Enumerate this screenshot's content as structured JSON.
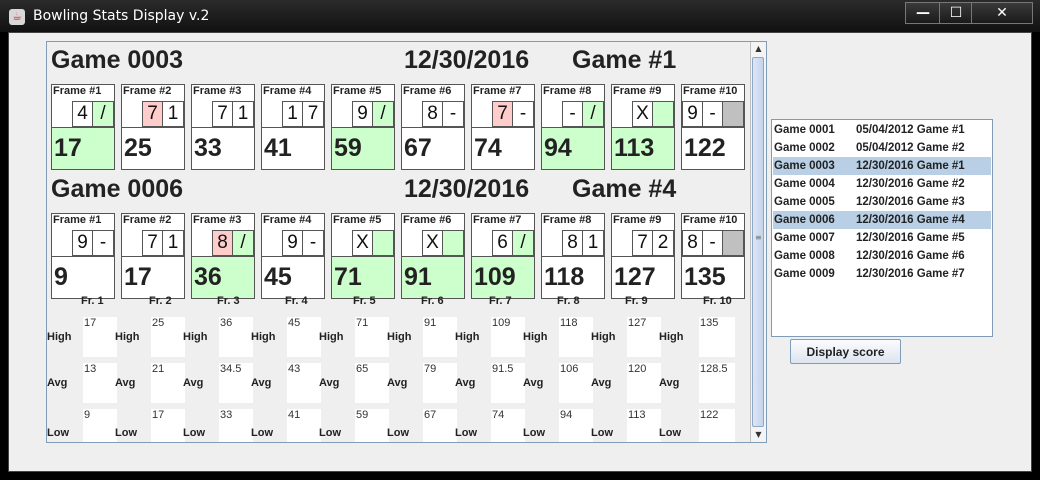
{
  "window": {
    "title": "Bowling Stats Display v.2",
    "icon": "java-icon",
    "minimize": "—",
    "maximize": "☐",
    "close": "✕"
  },
  "colors": {
    "strike": "#ccffcc",
    "split": "#ffcccc",
    "selection": "#b8cfe5"
  },
  "games": [
    {
      "id_label": "Game 0003",
      "date": "12/30/2016",
      "game_label": "Game #1",
      "frames": [
        {
          "label": "Frame #1",
          "balls": [
            "",
            "4",
            "/"
          ],
          "score": "17",
          "highlight": true
        },
        {
          "label": "Frame #2",
          "balls": [
            "",
            "7",
            "1"
          ],
          "score": "25",
          "split": true
        },
        {
          "label": "Frame #3",
          "balls": [
            "",
            "7",
            "1"
          ],
          "score": "33"
        },
        {
          "label": "Frame #4",
          "balls": [
            "",
            "1",
            "7"
          ],
          "score": "41"
        },
        {
          "label": "Frame #5",
          "balls": [
            "",
            "9",
            "/"
          ],
          "score": "59",
          "highlight": true
        },
        {
          "label": "Frame #6",
          "balls": [
            "",
            "8",
            "-"
          ],
          "score": "67"
        },
        {
          "label": "Frame #7",
          "balls": [
            "",
            "7",
            "-"
          ],
          "score": "74",
          "split": true
        },
        {
          "label": "Frame #8",
          "balls": [
            "",
            "-",
            "/"
          ],
          "score": "94",
          "highlight": true
        },
        {
          "label": "Frame #9",
          "balls": [
            "",
            "X",
            ""
          ],
          "score": "113",
          "highlight": true
        },
        {
          "label": "Frame #10",
          "balls": [
            "9",
            "-",
            ""
          ],
          "score": "122",
          "tenth": true
        }
      ]
    },
    {
      "id_label": "Game 0006",
      "date": "12/30/2016",
      "game_label": "Game #4",
      "frames": [
        {
          "label": "Frame #1",
          "balls": [
            "",
            "9",
            "-"
          ],
          "score": "9"
        },
        {
          "label": "Frame #2",
          "balls": [
            "",
            "7",
            "1"
          ],
          "score": "17"
        },
        {
          "label": "Frame #3",
          "balls": [
            "",
            "8",
            "/"
          ],
          "score": "36",
          "highlight": true,
          "split": true
        },
        {
          "label": "Frame #4",
          "balls": [
            "",
            "9",
            "-"
          ],
          "score": "45"
        },
        {
          "label": "Frame #5",
          "balls": [
            "",
            "X",
            ""
          ],
          "score": "71",
          "highlight": true
        },
        {
          "label": "Frame #6",
          "balls": [
            "",
            "X",
            ""
          ],
          "score": "91",
          "highlight": true
        },
        {
          "label": "Frame #7",
          "balls": [
            "",
            "6",
            "/"
          ],
          "score": "109",
          "highlight": true
        },
        {
          "label": "Frame #8",
          "balls": [
            "",
            "8",
            "1"
          ],
          "score": "118"
        },
        {
          "label": "Frame #9",
          "balls": [
            "",
            "7",
            "2"
          ],
          "score": "127"
        },
        {
          "label": "Frame #10",
          "balls": [
            "8",
            "-",
            ""
          ],
          "score": "135",
          "tenth": true
        }
      ]
    }
  ],
  "stats": {
    "frame_labels": [
      "Fr. 1",
      "Fr. 2",
      "Fr. 3",
      "Fr. 4",
      "Fr. 5",
      "Fr. 6",
      "Fr. 7",
      "Fr. 8",
      "Fr. 9",
      "Fr. 10"
    ],
    "row_labels": [
      "High",
      "Avg",
      "Low"
    ],
    "high": [
      "17",
      "25",
      "36",
      "45",
      "71",
      "91",
      "109",
      "118",
      "127",
      "135"
    ],
    "avg": [
      "13",
      "21",
      "34.5",
      "43",
      "65",
      "79",
      "91.5",
      "106",
      "120",
      "128.5"
    ],
    "low": [
      "9",
      "17",
      "33",
      "41",
      "59",
      "67",
      "74",
      "94",
      "113",
      "122"
    ]
  },
  "game_list": [
    {
      "id": "Game 0001",
      "desc": "05/04/2012 Game #1",
      "selected": false
    },
    {
      "id": "Game 0002",
      "desc": "05/04/2012 Game #2",
      "selected": false
    },
    {
      "id": "Game 0003",
      "desc": "12/30/2016 Game #1",
      "selected": true
    },
    {
      "id": "Game 0004",
      "desc": "12/30/2016 Game #2",
      "selected": false
    },
    {
      "id": "Game 0005",
      "desc": "12/30/2016 Game #3",
      "selected": false
    },
    {
      "id": "Game 0006",
      "desc": "12/30/2016 Game #4",
      "selected": true
    },
    {
      "id": "Game 0007",
      "desc": "12/30/2016 Game #5",
      "selected": false
    },
    {
      "id": "Game 0008",
      "desc": "12/30/2016 Game #6",
      "selected": false
    },
    {
      "id": "Game 0009",
      "desc": "12/30/2016 Game #7",
      "selected": false
    }
  ],
  "buttons": {
    "display_score": "Display score"
  }
}
